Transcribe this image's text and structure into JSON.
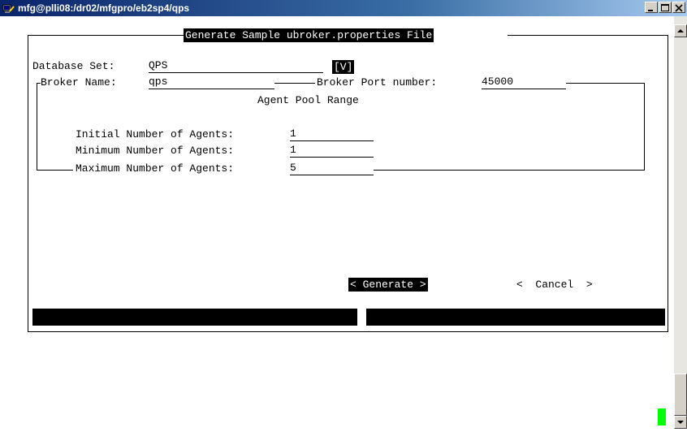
{
  "window": {
    "title": "mfg@plli08:/dr02/mfgpro/eb2sp4/qps"
  },
  "dialog": {
    "title": "Generate Sample ubroker.properties File"
  },
  "database": {
    "label": "Database Set:",
    "value": "QPS",
    "lookup": "[V]"
  },
  "broker": {
    "name_label": "Broker Name:",
    "name_value": "qps",
    "port_label": "Broker Port number:",
    "port_value": "45000"
  },
  "agents": {
    "section_title": "Agent Pool Range",
    "initial_label": "Initial Number of Agents:",
    "initial_value": "1",
    "minimum_label": "Minimum Number of Agents:",
    "minimum_value": "1",
    "maximum_label": "Maximum Number of Agents:",
    "maximum_value": "5"
  },
  "buttons": {
    "generate": "< Generate >",
    "cancel": "<  Cancel  >"
  },
  "colors": {
    "cursor": "#00ff00",
    "inverse_bg": "#000000"
  },
  "icons": {
    "app": "putty-terminal-icon",
    "minimize": "minimize-icon",
    "maximize": "maximize-icon",
    "close": "close-icon"
  }
}
